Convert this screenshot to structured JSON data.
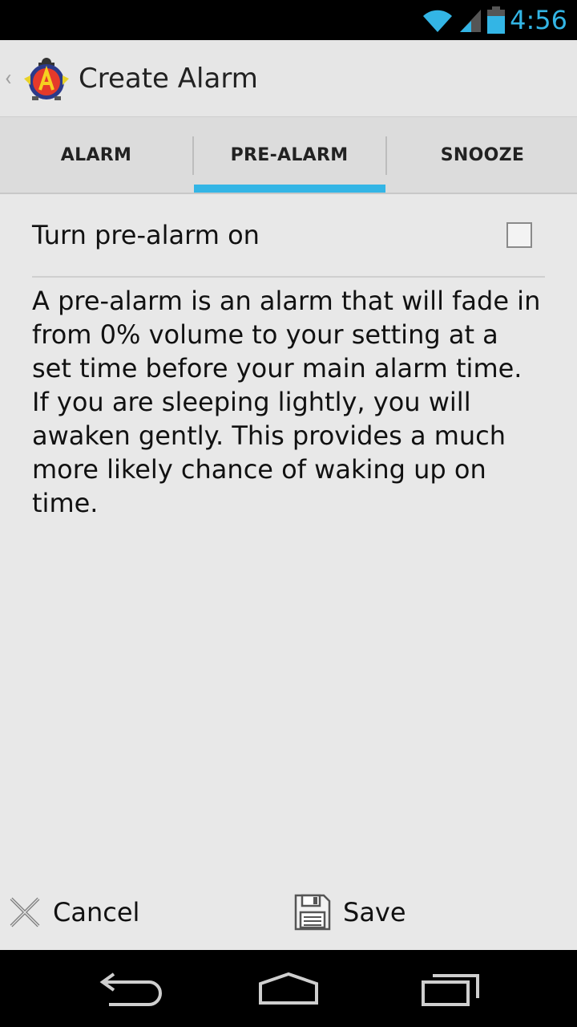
{
  "status_bar": {
    "time": "4:56"
  },
  "action_bar": {
    "title": "Create Alarm"
  },
  "tabs": [
    {
      "label": "ALARM",
      "selected": false
    },
    {
      "label": "PRE-ALARM",
      "selected": true
    },
    {
      "label": "SNOOZE",
      "selected": false
    }
  ],
  "pre_alarm": {
    "toggle_label": "Turn pre-alarm on",
    "checked": false,
    "description": "A pre-alarm is an alarm that will fade in from 0% volume to your setting at a set time before your main alarm time. If you are sleeping lightly, you will awaken gently. This provides a much more likely chance of waking up on time."
  },
  "bottom_actions": {
    "cancel_label": "Cancel",
    "save_label": "Save"
  },
  "colors": {
    "accent": "#33b5e5",
    "background": "#e8e8e8",
    "status_bar": "#000000"
  },
  "icons": {
    "status": [
      "wifi-icon",
      "cell-signal-icon",
      "battery-icon"
    ],
    "nav": [
      "back-icon",
      "home-icon",
      "recent-apps-icon"
    ],
    "actions": [
      "close-x-icon",
      "save-floppy-icon"
    ]
  }
}
